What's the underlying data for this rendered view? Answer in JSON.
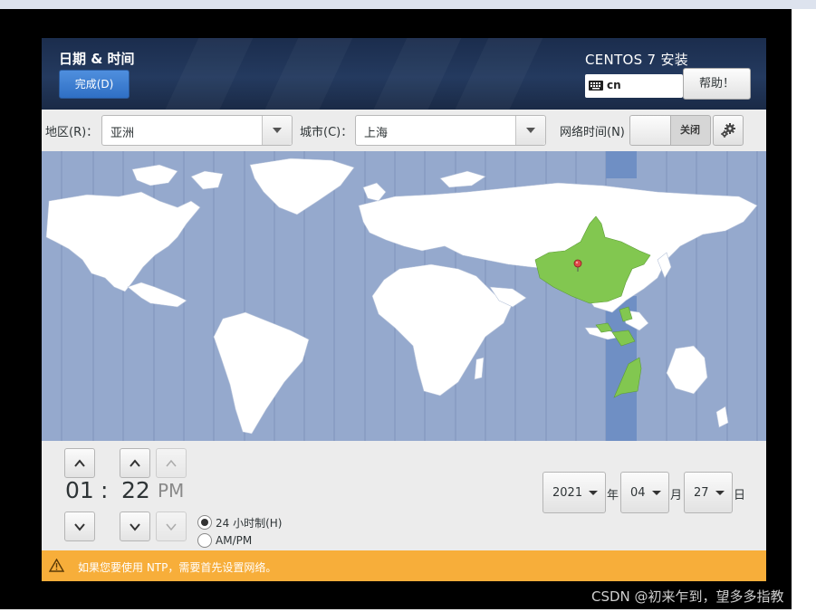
{
  "header": {
    "title": "日期 & 时间",
    "done_label": "完成(D)",
    "install_title": "CENTOS 7 安装",
    "keyboard_layout": "cn",
    "help_label": "帮助！"
  },
  "toolbar": {
    "region_label": "地区(R)：",
    "region_value": "亚洲",
    "city_label": "城市(C)：",
    "city_value": "上海",
    "ntp_label": "网络时间(N)",
    "ntp_state": "关闭"
  },
  "map": {
    "selected_timezone_color": "#82c750",
    "selected_band_color": "#6f8fc4",
    "ocean_color": "#95a9cd",
    "pin_icon": "map-pin-icon"
  },
  "time": {
    "hour": "01",
    "separator": ":",
    "minute": "22",
    "ampm": "PM",
    "format_24h_label": "24 小时制(H)",
    "format_ampm_label": "AM/PM",
    "selected_format": "24h"
  },
  "date": {
    "year": "2021",
    "year_suffix": "年",
    "month": "04",
    "month_suffix": "月",
    "day": "27",
    "day_suffix": "日"
  },
  "warning": {
    "icon": "warning-icon",
    "text": "如果您要使用 NTP，需要首先设置网络。",
    "color": "#f7ae3a"
  },
  "watermark": "CSDN @初来乍到，望多多指教"
}
